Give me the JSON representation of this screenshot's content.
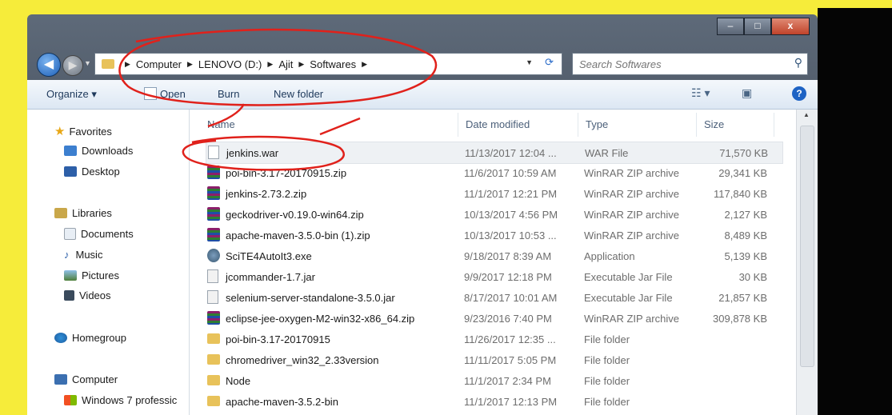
{
  "window": {
    "caption_buttons": {
      "minimize": "–",
      "maximize": "□",
      "close": "x"
    }
  },
  "address": {
    "breadcrumb": [
      "Computer",
      "LENOVO (D:)",
      "Ajit",
      "Softwares"
    ],
    "search_placeholder": "Search Softwares"
  },
  "toolbar": {
    "organize": "Organize ▾",
    "open": "Open",
    "burn": "Burn",
    "new_folder": "New folder"
  },
  "sidebar": {
    "favorites": "Favorites",
    "downloads": "Downloads",
    "desktop": "Desktop",
    "libraries": "Libraries",
    "documents": "Documents",
    "music": "Music",
    "pictures": "Pictures",
    "videos": "Videos",
    "homegroup": "Homegroup",
    "computer": "Computer",
    "windows7": "Windows 7 professic"
  },
  "columns": {
    "name": "Name",
    "date": "Date modified",
    "type": "Type",
    "size": "Size"
  },
  "files": [
    {
      "name": "jenkins.war",
      "date": "11/13/2017 12:04 ...",
      "type": "WAR File",
      "size": "71,570 KB",
      "icon": "file-icon"
    },
    {
      "name": "poi-bin-3.17-20170915.zip",
      "date": "11/6/2017 10:59 AM",
      "type": "WinRAR ZIP archive",
      "size": "29,341 KB",
      "icon": "winrar-icon"
    },
    {
      "name": "jenkins-2.73.2.zip",
      "date": "11/1/2017 12:21 PM",
      "type": "WinRAR ZIP archive",
      "size": "117,840 KB",
      "icon": "winrar-icon"
    },
    {
      "name": "geckodriver-v0.19.0-win64.zip",
      "date": "10/13/2017 4:56 PM",
      "type": "WinRAR ZIP archive",
      "size": "2,127 KB",
      "icon": "winrar-icon"
    },
    {
      "name": "apache-maven-3.5.0-bin (1).zip",
      "date": "10/13/2017 10:53 ...",
      "type": "WinRAR ZIP archive",
      "size": "8,489 KB",
      "icon": "winrar-icon"
    },
    {
      "name": "SciTE4AutoIt3.exe",
      "date": "9/18/2017 8:39 AM",
      "type": "Application",
      "size": "5,139 KB",
      "icon": "installer-icon"
    },
    {
      "name": "jcommander-1.7.jar",
      "date": "9/9/2017 12:18 PM",
      "type": "Executable Jar File",
      "size": "30 KB",
      "icon": "jar-icon"
    },
    {
      "name": "selenium-server-standalone-3.5.0.jar",
      "date": "8/17/2017 10:01 AM",
      "type": "Executable Jar File",
      "size": "21,857 KB",
      "icon": "jar-icon"
    },
    {
      "name": "eclipse-jee-oxygen-M2-win32-x86_64.zip",
      "date": "9/23/2016 7:40 PM",
      "type": "WinRAR ZIP archive",
      "size": "309,878 KB",
      "icon": "winrar-icon"
    },
    {
      "name": "poi-bin-3.17-20170915",
      "date": "11/26/2017 12:35 ...",
      "type": "File folder",
      "size": "",
      "icon": "folder-icon"
    },
    {
      "name": "chromedriver_win32_2.33version",
      "date": "11/11/2017 5:05 PM",
      "type": "File folder",
      "size": "",
      "icon": "folder-icon"
    },
    {
      "name": "Node",
      "date": "11/1/2017 2:34 PM",
      "type": "File folder",
      "size": "",
      "icon": "folder-icon"
    },
    {
      "name": "apache-maven-3.5.2-bin",
      "date": "11/1/2017 12:13 PM",
      "type": "File folder",
      "size": "",
      "icon": "folder-icon"
    }
  ],
  "colors": {
    "frame": "#f6ec3a",
    "annotation": "#e0211b",
    "selection": "#eef1f4"
  }
}
